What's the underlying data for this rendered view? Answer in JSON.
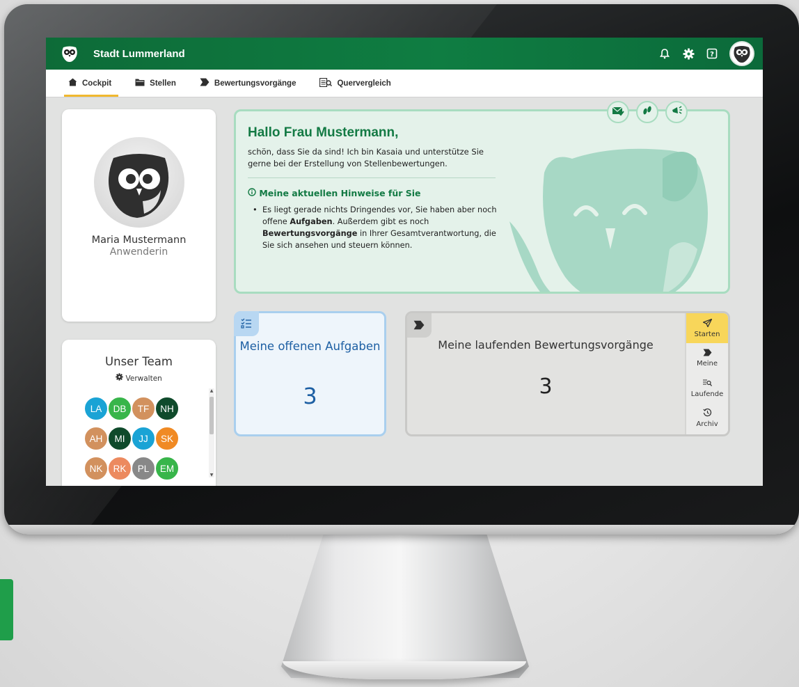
{
  "app": {
    "brand": "Stadt Lummerland"
  },
  "topbar": {
    "icons": [
      "bell-icon",
      "gear-icon",
      "help-icon",
      "user-avatar"
    ]
  },
  "nav": {
    "items": [
      {
        "label": "Cockpit",
        "icon": "home-icon",
        "active": true
      },
      {
        "label": "Stellen",
        "icon": "folder-icon",
        "active": false
      },
      {
        "label": "Bewertungsvorgänge",
        "icon": "chevron-flag-icon",
        "active": false
      },
      {
        "label": "Quervergleich",
        "icon": "compare-icon",
        "active": false
      }
    ]
  },
  "profile": {
    "name": "Maria Mustermann",
    "role": "Anwenderin"
  },
  "team": {
    "title": "Unser Team",
    "manage_label": "Verwalten",
    "members": [
      {
        "initials": "LA",
        "color": "#1aa3d5"
      },
      {
        "initials": "DB",
        "color": "#38b54a"
      },
      {
        "initials": "TF",
        "color": "#d2915e"
      },
      {
        "initials": "NH",
        "color": "#0f4a2b"
      },
      {
        "initials": "AH",
        "color": "#d2915e"
      },
      {
        "initials": "MI",
        "color": "#0f4a2b"
      },
      {
        "initials": "JJ",
        "color": "#1aa3d5"
      },
      {
        "initials": "SK",
        "color": "#f08a24"
      },
      {
        "initials": "NK",
        "color": "#d2915e"
      },
      {
        "initials": "RK",
        "color": "#ec8a5f"
      },
      {
        "initials": "PL",
        "color": "#888888"
      },
      {
        "initials": "EM",
        "color": "#38b54a"
      }
    ]
  },
  "welcome": {
    "title": "Hallo Frau Mustermann,",
    "text": "schön, dass Sie da sind! Ich bin Kasaia und unterstütze Sie gerne bei der Erstellung von Stellenbewertungen.",
    "hints_title": "Meine aktuellen Hinweise für Sie",
    "hint_parts": {
      "p1": "Es liegt gerade nichts Dringendes vor, Sie haben aber noch offene ",
      "b1": "Aufgaben",
      "p2": ". Außerdem gibt es noch ",
      "b2": "Bewertungsvorgänge",
      "p3": " in Ihrer Gesamtverantwortung, die Sie sich ansehen und steuern können."
    },
    "actions": [
      "mail-check-icon",
      "footsteps-icon",
      "megaphone-icon"
    ]
  },
  "tasks": {
    "title": "Meine offenen Aufgaben",
    "count": "3"
  },
  "processes": {
    "title": "Meine laufenden Bewertungsvorgänge",
    "count": "3",
    "side_menu": [
      {
        "label": "Starten",
        "icon": "send-icon"
      },
      {
        "label": "Meine",
        "icon": "chevron-flag-icon"
      },
      {
        "label": "Laufende",
        "icon": "search-list-icon"
      },
      {
        "label": "Archiv",
        "icon": "history-icon"
      }
    ]
  },
  "colors": {
    "primary_green": "#0f7d42",
    "accent_yellow": "#f1b82e",
    "welcome_bg": "#e4f2ea",
    "tasks_blue": "#1d5fa3"
  }
}
